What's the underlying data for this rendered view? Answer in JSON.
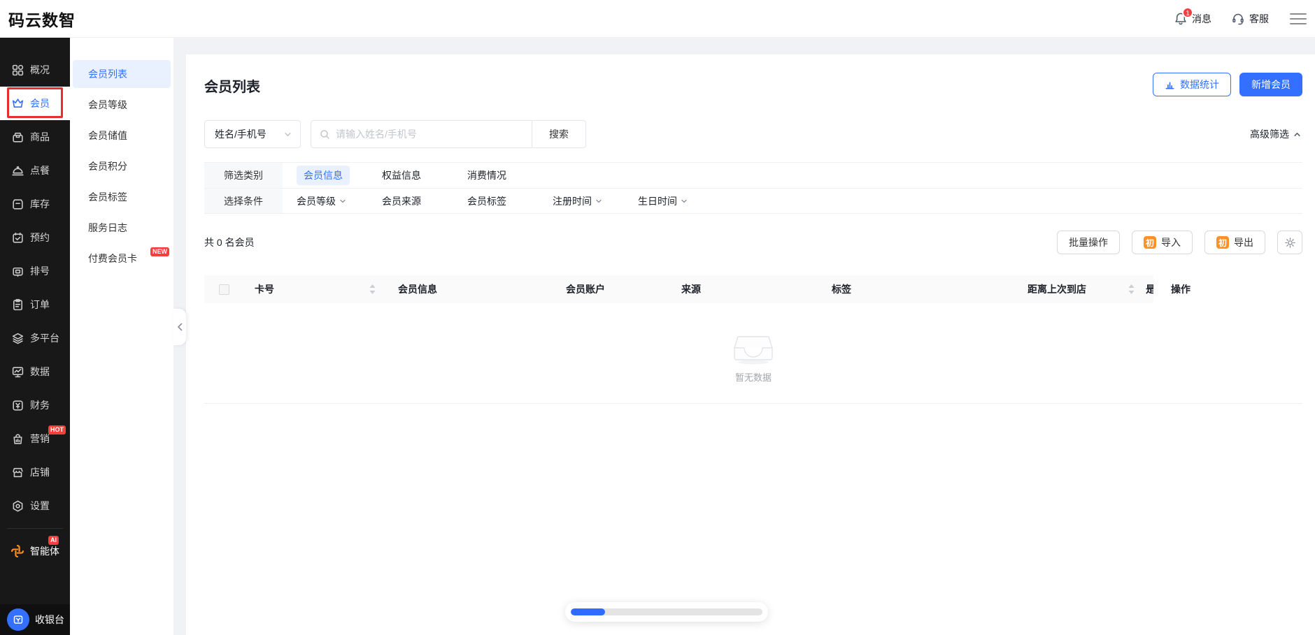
{
  "header": {
    "logo": "码云数智",
    "messages": {
      "label": "消息",
      "badge": "1"
    },
    "support": {
      "label": "客服"
    }
  },
  "colors": {
    "accent": "#3370ff",
    "accent_light": "#e9f1ff",
    "orange": "#ff9226",
    "red": "#f53f3f",
    "sidebar_bg": "#181818",
    "page_bg": "#f0f2f5",
    "annotation": "#e62e2e"
  },
  "sidebar": {
    "items": [
      {
        "label": "概况"
      },
      {
        "label": "会员",
        "active": true
      },
      {
        "label": "商品"
      },
      {
        "label": "点餐"
      },
      {
        "label": "库存"
      },
      {
        "label": "预约"
      },
      {
        "label": "排号"
      },
      {
        "label": "订单"
      },
      {
        "label": "多平台"
      },
      {
        "label": "数据"
      },
      {
        "label": "财务"
      },
      {
        "label": "营销",
        "badge": "HOT"
      },
      {
        "label": "店铺"
      },
      {
        "label": "设置"
      }
    ],
    "agent": {
      "label": "智能体",
      "badge": "AI"
    },
    "cashier": {
      "label": "收银台"
    }
  },
  "submenu": {
    "items": [
      {
        "label": "会员列表",
        "active": true
      },
      {
        "label": "会员等级"
      },
      {
        "label": "会员储值"
      },
      {
        "label": "会员积分"
      },
      {
        "label": "会员标签"
      },
      {
        "label": "服务日志"
      },
      {
        "label": "付费会员卡",
        "badge": "NEW"
      }
    ]
  },
  "main": {
    "title": "会员列表",
    "stats_button": "数据统计",
    "add_button": "新增会员",
    "search": {
      "field_selector": "姓名/手机号",
      "placeholder": "请输入姓名/手机号",
      "search_button": "搜索",
      "advanced_filter": "高级筛选"
    },
    "filter": {
      "category_label": "筛选类别",
      "categories": [
        {
          "label": "会员信息",
          "active": true
        },
        {
          "label": "权益信息"
        },
        {
          "label": "消费情况"
        }
      ],
      "condition_label": "选择条件",
      "conditions": [
        {
          "label": "会员等级",
          "dropdown": true
        },
        {
          "label": "会员来源",
          "dropdown": false
        },
        {
          "label": "会员标签",
          "dropdown": false
        },
        {
          "label": "注册时间",
          "dropdown": true
        },
        {
          "label": "生日时间",
          "dropdown": true
        }
      ]
    },
    "toolbar": {
      "count_text": "共 0 名会员",
      "batch_button": "批量操作",
      "import_button": "导入",
      "export_button": "导出",
      "perm_badge": "初"
    },
    "table": {
      "columns": [
        {
          "label": "卡号",
          "sortable": true
        },
        {
          "label": "会员信息"
        },
        {
          "label": "会员账户"
        },
        {
          "label": "来源"
        },
        {
          "label": "标签"
        },
        {
          "label": "距离上次到店",
          "sortable": true
        },
        {
          "label": "是"
        },
        {
          "label": "操作",
          "fixed": true
        }
      ],
      "empty_text": "暂无数据"
    },
    "progress": {
      "percent": 18,
      "fill_style": "width:18%"
    }
  }
}
